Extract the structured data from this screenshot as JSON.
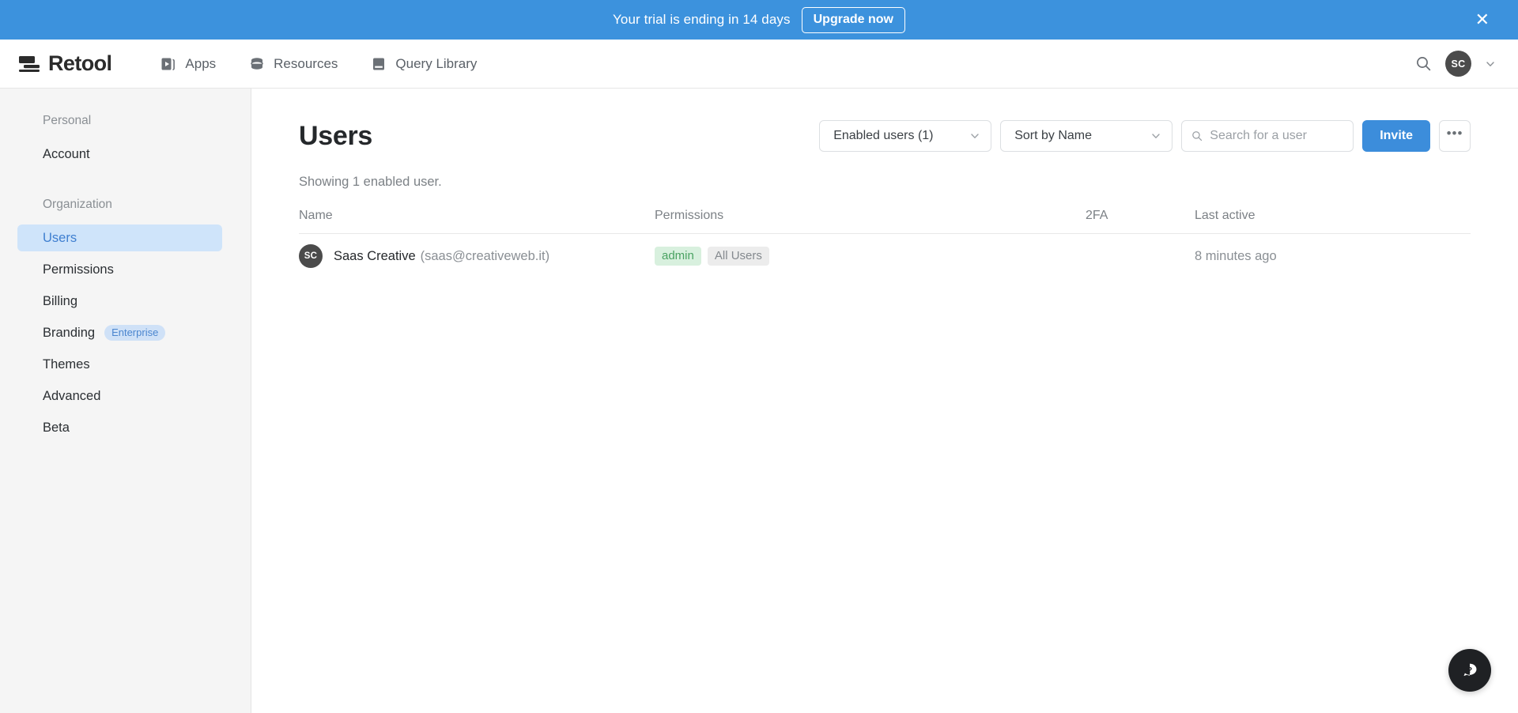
{
  "banner": {
    "text": "Your trial is ending in 14 days",
    "upgrade_label": "Upgrade now",
    "close_icon": "close-icon",
    "background_color": "#3c92dd"
  },
  "nav": {
    "brand": "Retool",
    "brand_logo_icon": "retool-logo-icon",
    "items": [
      {
        "label": "Apps",
        "icon": "apps-icon"
      },
      {
        "label": "Resources",
        "icon": "database-icon"
      },
      {
        "label": "Query Library",
        "icon": "book-icon"
      }
    ],
    "search_icon": "search-icon",
    "avatar_initials": "SC",
    "caret_icon": "chevron-down-icon"
  },
  "sidebar": {
    "groups": [
      {
        "label": "Personal",
        "items": [
          {
            "label": "Account",
            "active": false
          }
        ]
      },
      {
        "label": "Organization",
        "items": [
          {
            "label": "Users",
            "active": true
          },
          {
            "label": "Permissions",
            "active": false
          },
          {
            "label": "Billing",
            "active": false
          },
          {
            "label": "Branding",
            "active": false,
            "badge": "Enterprise"
          },
          {
            "label": "Themes",
            "active": false
          },
          {
            "label": "Advanced",
            "active": false
          },
          {
            "label": "Beta",
            "active": false
          }
        ]
      }
    ]
  },
  "main": {
    "title": "Users",
    "subtitle": "Showing 1 enabled user.",
    "toolbar": {
      "filter_select": {
        "value": "Enabled users (1)",
        "icon": "chevron-down-icon"
      },
      "sort_select": {
        "value": "Sort by Name",
        "icon": "chevron-down-icon"
      },
      "search": {
        "value": "",
        "placeholder": "Search for a user",
        "icon": "search-icon"
      },
      "invite_label": "Invite",
      "more_label": "•••"
    },
    "table": {
      "columns": [
        "Name",
        "Permissions",
        "2FA",
        "Last active"
      ],
      "rows": [
        {
          "avatar_initials": "SC",
          "name": "Saas Creative",
          "email": "(saas@creativeweb.it)",
          "permissions": [
            {
              "label": "admin",
              "style": "green"
            },
            {
              "label": "All Users",
              "style": "gray"
            }
          ],
          "twofa": "",
          "last_active": "8 minutes ago"
        }
      ]
    }
  },
  "help": {
    "icon": "help-question-bubble-icon"
  },
  "colors": {
    "accent_blue": "#3c8ddb",
    "banner_blue": "#3c92dd",
    "active_item_bg": "#cfe4fa",
    "active_item_text": "#3f7fd0",
    "tag_green_bg": "#d8f0de",
    "tag_green_text": "#4aa262"
  }
}
